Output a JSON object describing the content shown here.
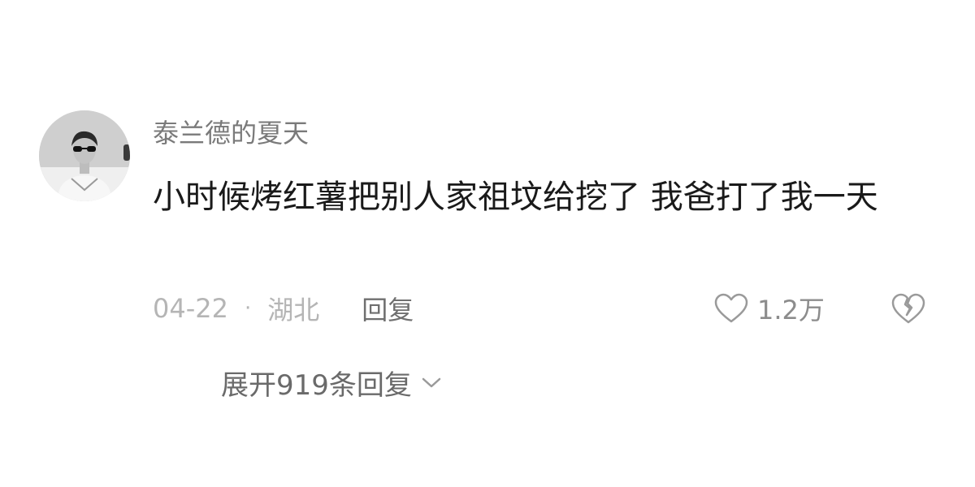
{
  "comment": {
    "username": "泰兰德的夏天",
    "text": "小时候烤红薯把别人家祖坟给挖了 我爸打了我一天",
    "date": "04-22",
    "separator": "·",
    "location": "湖北",
    "reply_label": "回复",
    "like_count": "1.2万",
    "avatar_icon": "avatar-photo-icon",
    "like_icon": "heart-outline-icon",
    "dislike_icon": "broken-heart-icon"
  },
  "replies": {
    "expand_label": "展开919条回复",
    "expand_icon": "chevron-down-icon"
  }
}
